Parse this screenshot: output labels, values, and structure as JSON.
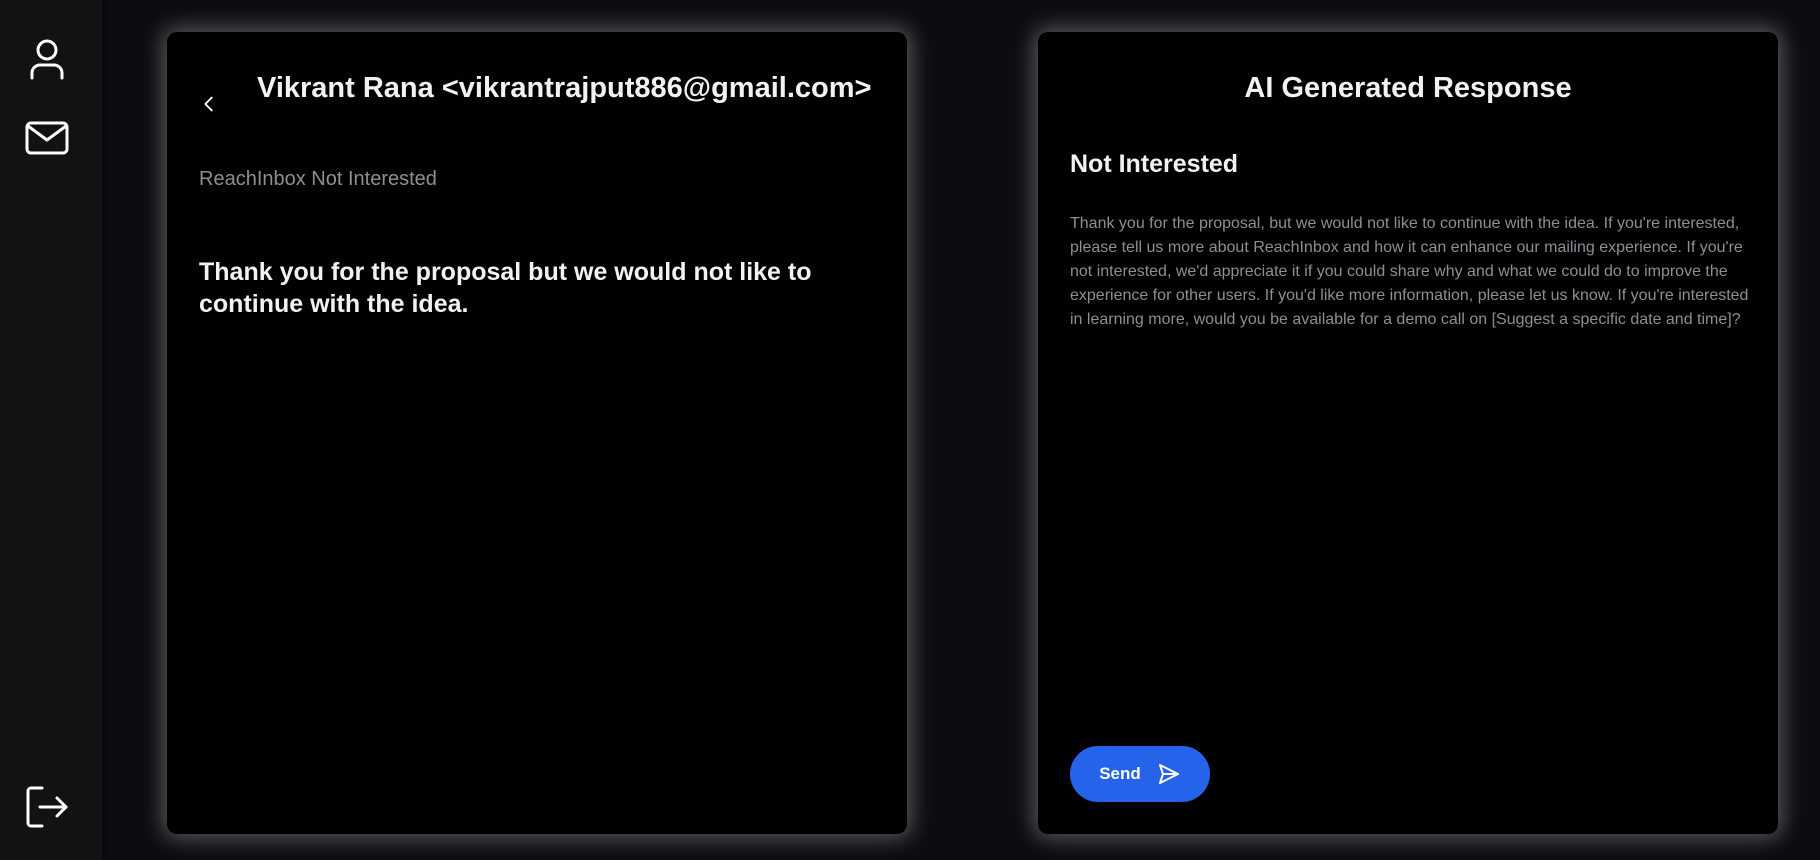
{
  "sidebar": {
    "icons": [
      "profile-icon",
      "mail-icon",
      "logout-icon"
    ]
  },
  "email": {
    "header": "Vikrant Rana <vikrantrajput886@gmail.com>",
    "subject": "ReachInbox Not Interested",
    "body": "Thank you for the proposal but we would not like to continue with the idea."
  },
  "ai_response": {
    "title": "AI Generated Response",
    "label": "Not Interested",
    "body": "Thank you for the proposal, but we would not like to continue with the idea. If you're interested, please tell us more about ReachInbox and how it can enhance our mailing experience. If you're not interested, we'd appreciate it if you could share why and what we could do to improve the experience for other users. If you'd like more information, please let us know. If you're interested in learning more, would you be available for a demo call on [Suggest a specific date and time]?",
    "send_label": "Send"
  },
  "colors": {
    "accent": "#2563eb",
    "background": "#000000",
    "sidebar": "#101214",
    "muted_text": "#8c8f94",
    "text": "#f2f2f2"
  }
}
